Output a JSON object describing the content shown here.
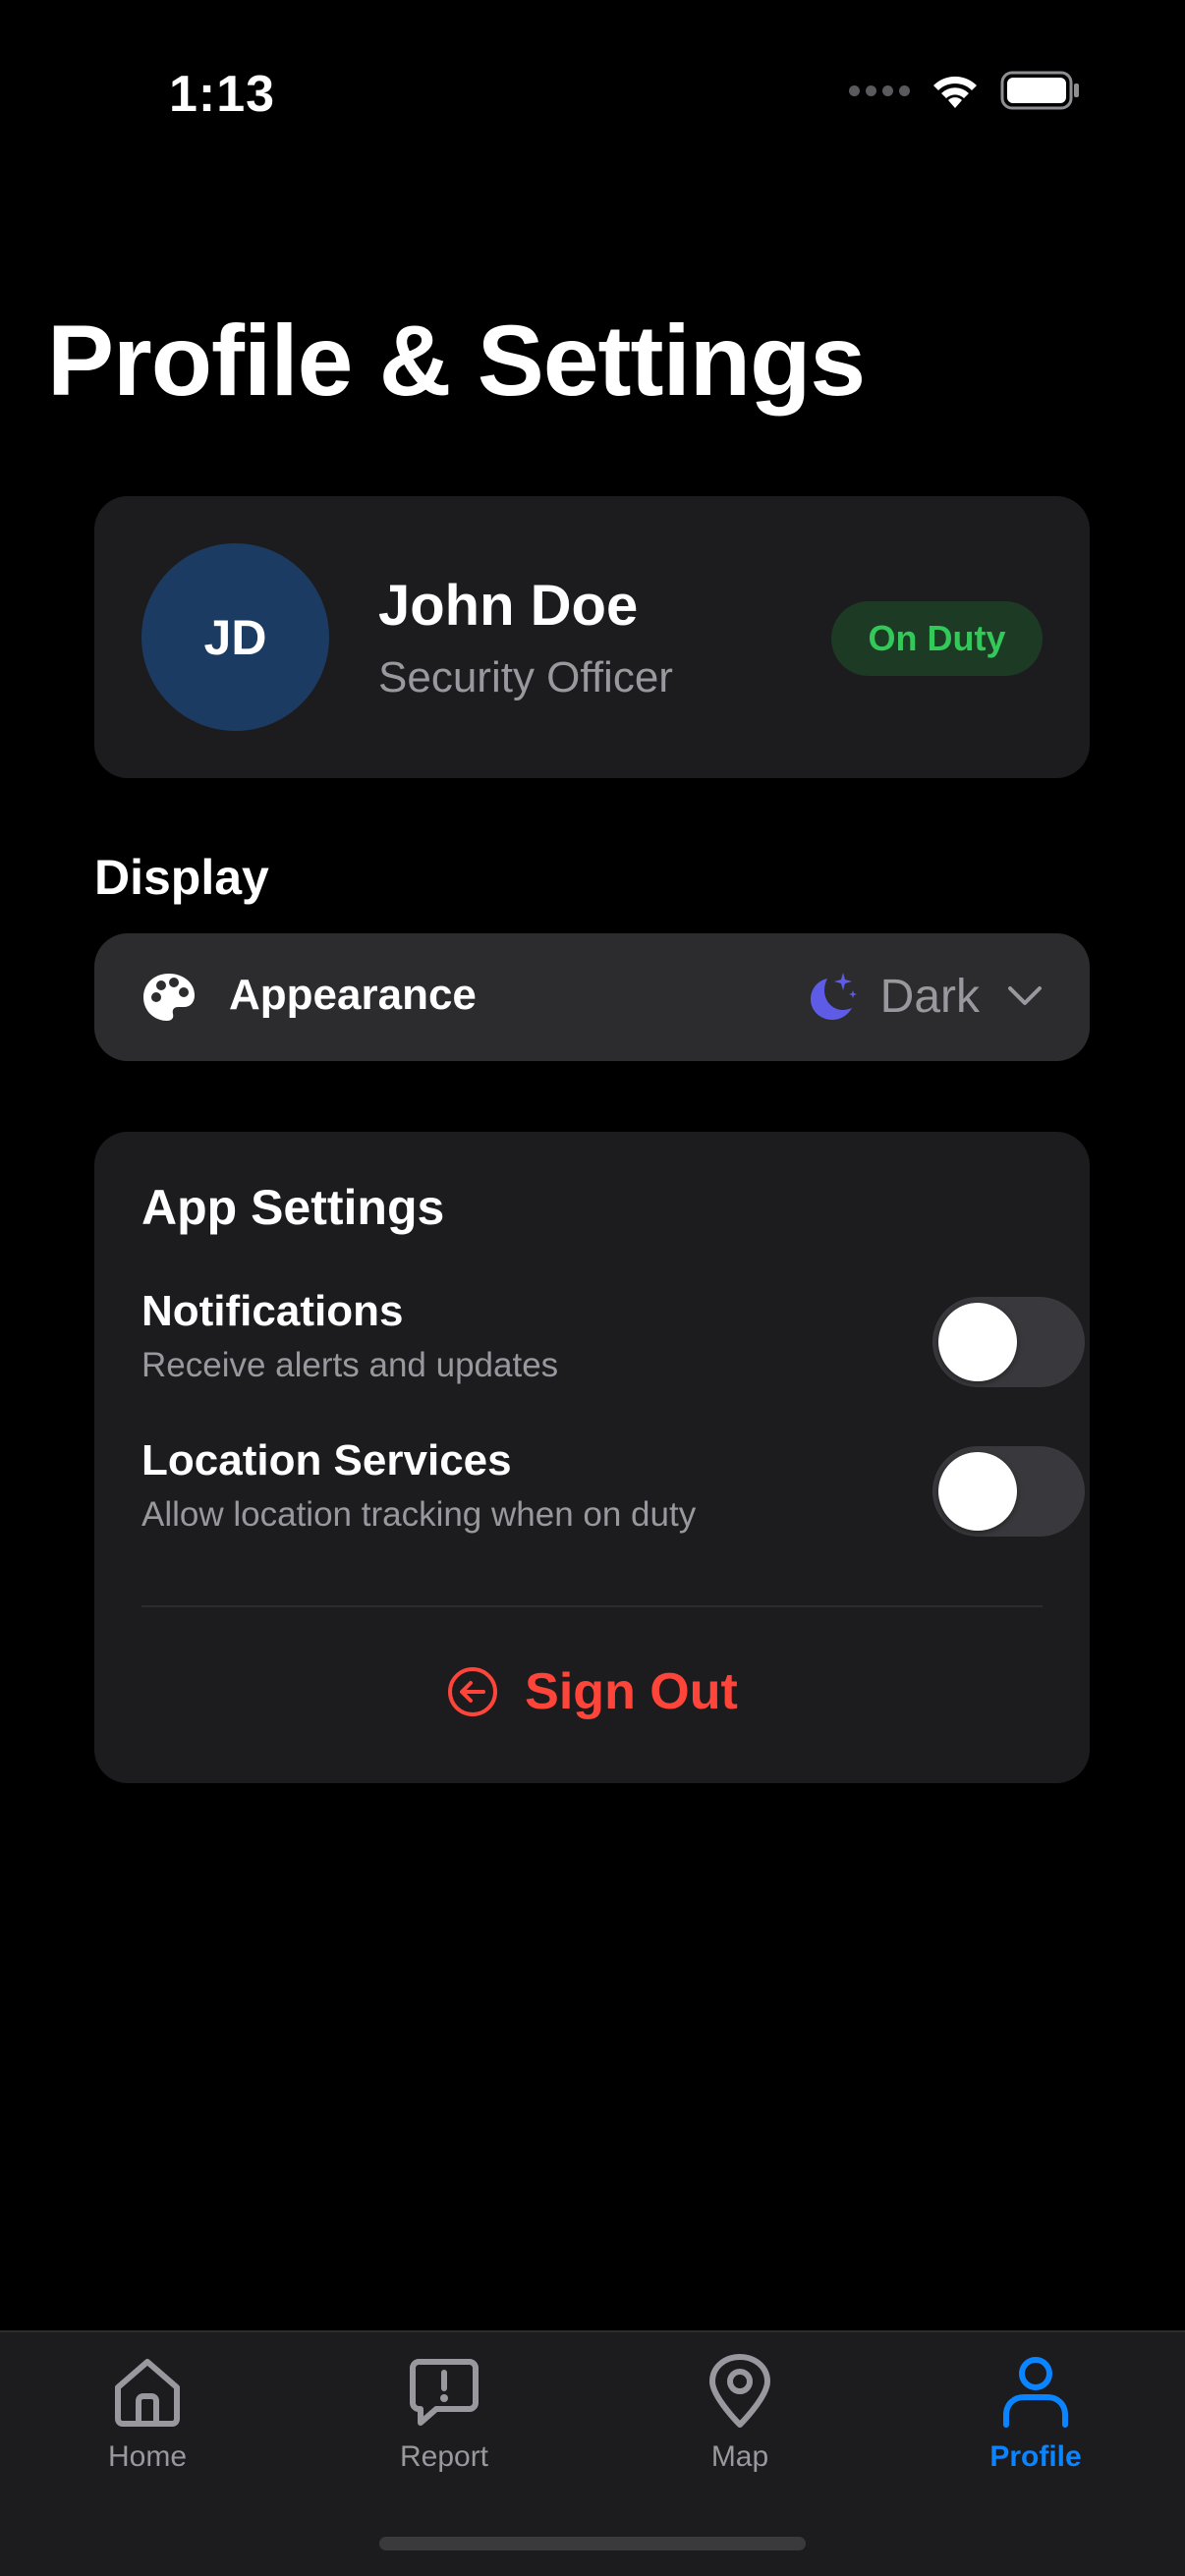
{
  "status_bar": {
    "time": "1:13"
  },
  "page": {
    "title": "Profile & Settings"
  },
  "profile": {
    "initials": "JD",
    "name": "John Doe",
    "role": "Security Officer",
    "status": "On Duty"
  },
  "display": {
    "section_label": "Display",
    "appearance_label": "Appearance",
    "appearance_value": "Dark"
  },
  "app_settings": {
    "title": "App Settings",
    "items": [
      {
        "title": "Notifications",
        "description": "Receive alerts and updates",
        "enabled": false
      },
      {
        "title": "Location Services",
        "description": "Allow location tracking when on duty",
        "enabled": false
      }
    ],
    "sign_out_label": "Sign Out"
  },
  "tabs": [
    {
      "label": "Home",
      "icon": "home-icon",
      "active": false
    },
    {
      "label": "Report",
      "icon": "report-icon",
      "active": false
    },
    {
      "label": "Map",
      "icon": "map-pin-icon",
      "active": false
    },
    {
      "label": "Profile",
      "icon": "person-icon",
      "active": true
    }
  ],
  "colors": {
    "background": "#000000",
    "card": "#1c1c1e",
    "row": "#2c2c2e",
    "accent": "#0a84ff",
    "success": "#34c759",
    "danger": "#ff453a",
    "avatar": "#1c3b63",
    "moon": "#5e5ce6"
  }
}
